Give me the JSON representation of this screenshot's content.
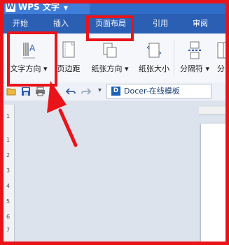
{
  "app": {
    "title": "WPS 文字"
  },
  "tabs": [
    "开始",
    "插入",
    "页面布局",
    "引用",
    "审阅"
  ],
  "ribbon": {
    "text_direction": "文字方向",
    "margins": "页边距",
    "orientation": "纸张方向",
    "size": "纸张大小",
    "breaks": "分隔符",
    "columns": "分"
  },
  "document_tab": {
    "title": "Docer-在线模板",
    "icon": "D"
  },
  "ruler_numbers": [
    "1",
    "1",
    "2",
    "3",
    "4",
    "5",
    "6",
    "7"
  ],
  "colors": {
    "title_bar": "#2f6cc7",
    "tab_bar": "#2b5fb4",
    "annotation_red": "#e8141a"
  }
}
